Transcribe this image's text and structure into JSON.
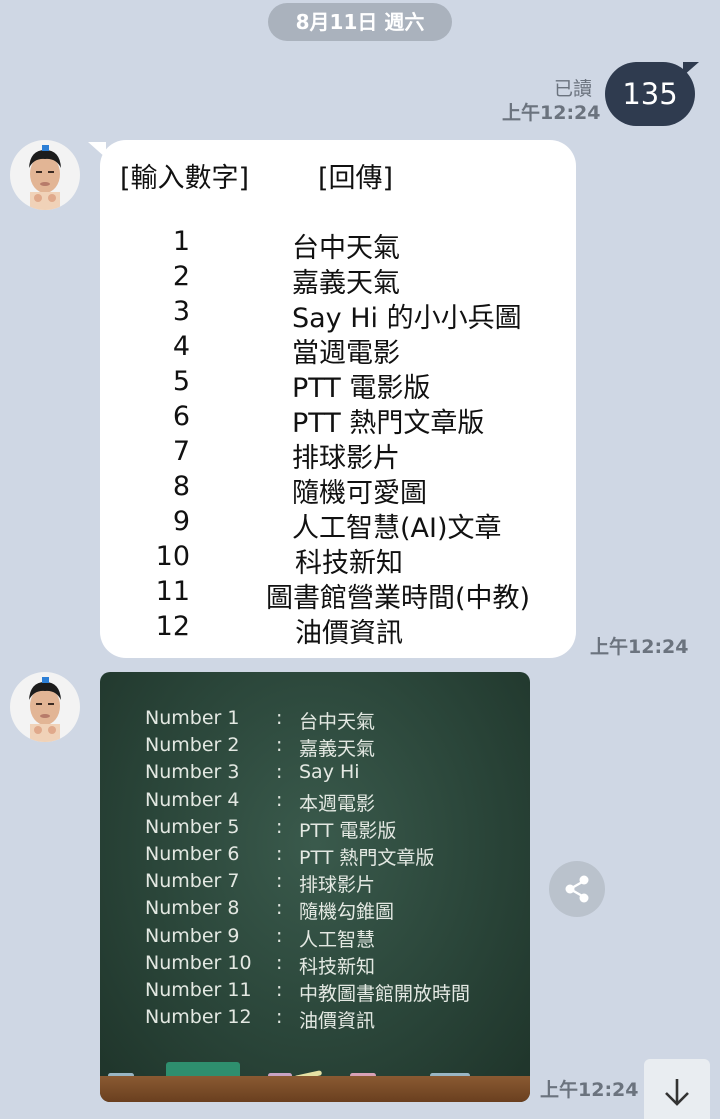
{
  "date_divider": "8月11日 週六",
  "outgoing": {
    "read_label": "已讀",
    "time": "上午12:24",
    "text": "135"
  },
  "menu_message": {
    "header_left": "[輸入數字]",
    "header_right": "[回傳]",
    "rows": [
      {
        "num": "1",
        "text": "台中天氣"
      },
      {
        "num": "2",
        "text": "嘉義天氣"
      },
      {
        "num": "3",
        "text": "Say Hi 的小小兵圖"
      },
      {
        "num": "4",
        "text": "當週電影"
      },
      {
        "num": "5",
        "text": "PTT 電影版"
      },
      {
        "num": "6",
        "text": "PTT 熱門文章版"
      },
      {
        "num": "7",
        "text": "排球影片"
      },
      {
        "num": "8",
        "text": "隨機可愛圖"
      },
      {
        "num": "9",
        "text": "人工智慧(AI)文章"
      },
      {
        "num": "10",
        "text": "科技新知"
      },
      {
        "num": "11",
        "text": "圖書館營業時間(中教)"
      },
      {
        "num": "12",
        "text": "油價資訊"
      }
    ],
    "time": "上午12:24"
  },
  "image_message": {
    "rows": [
      {
        "label": "Number 1",
        "sep": ":",
        "text": "台中天氣"
      },
      {
        "label": "Number 2",
        "sep": ":",
        "text": "嘉義天氣"
      },
      {
        "label": "Number 3",
        "sep": ":",
        "text": "Say Hi"
      },
      {
        "label": "Number 4",
        "sep": ":",
        "text": "本週電影"
      },
      {
        "label": "Number 5",
        "sep": ":",
        "text": "PTT 電影版"
      },
      {
        "label": "Number 6",
        "sep": ":",
        "text": "PTT 熱門文章版"
      },
      {
        "label": "Number 7",
        "sep": ":",
        "text": "排球影片"
      },
      {
        "label": "Number 8",
        "sep": ":",
        "text": "隨機勾錐圖"
      },
      {
        "label": "Number 9",
        "sep": ":",
        "text": "人工智慧"
      },
      {
        "label": "Number 10",
        "sep": ":",
        "text": "科技新知"
      },
      {
        "label": "Number 11",
        "sep": ":",
        "text": "中教圖書館開放時間"
      },
      {
        "label": "Number 12",
        "sep": ":",
        "text": "油價資訊"
      }
    ],
    "time": "上午12:24"
  },
  "icons": {
    "share": "share-icon",
    "scroll_down": "arrow-down-icon"
  },
  "colors": {
    "background": "#cfd7e4",
    "outgoing_bubble": "#2f3b4f",
    "incoming_bubble": "#ffffff",
    "chalkboard": "#2a4539"
  }
}
